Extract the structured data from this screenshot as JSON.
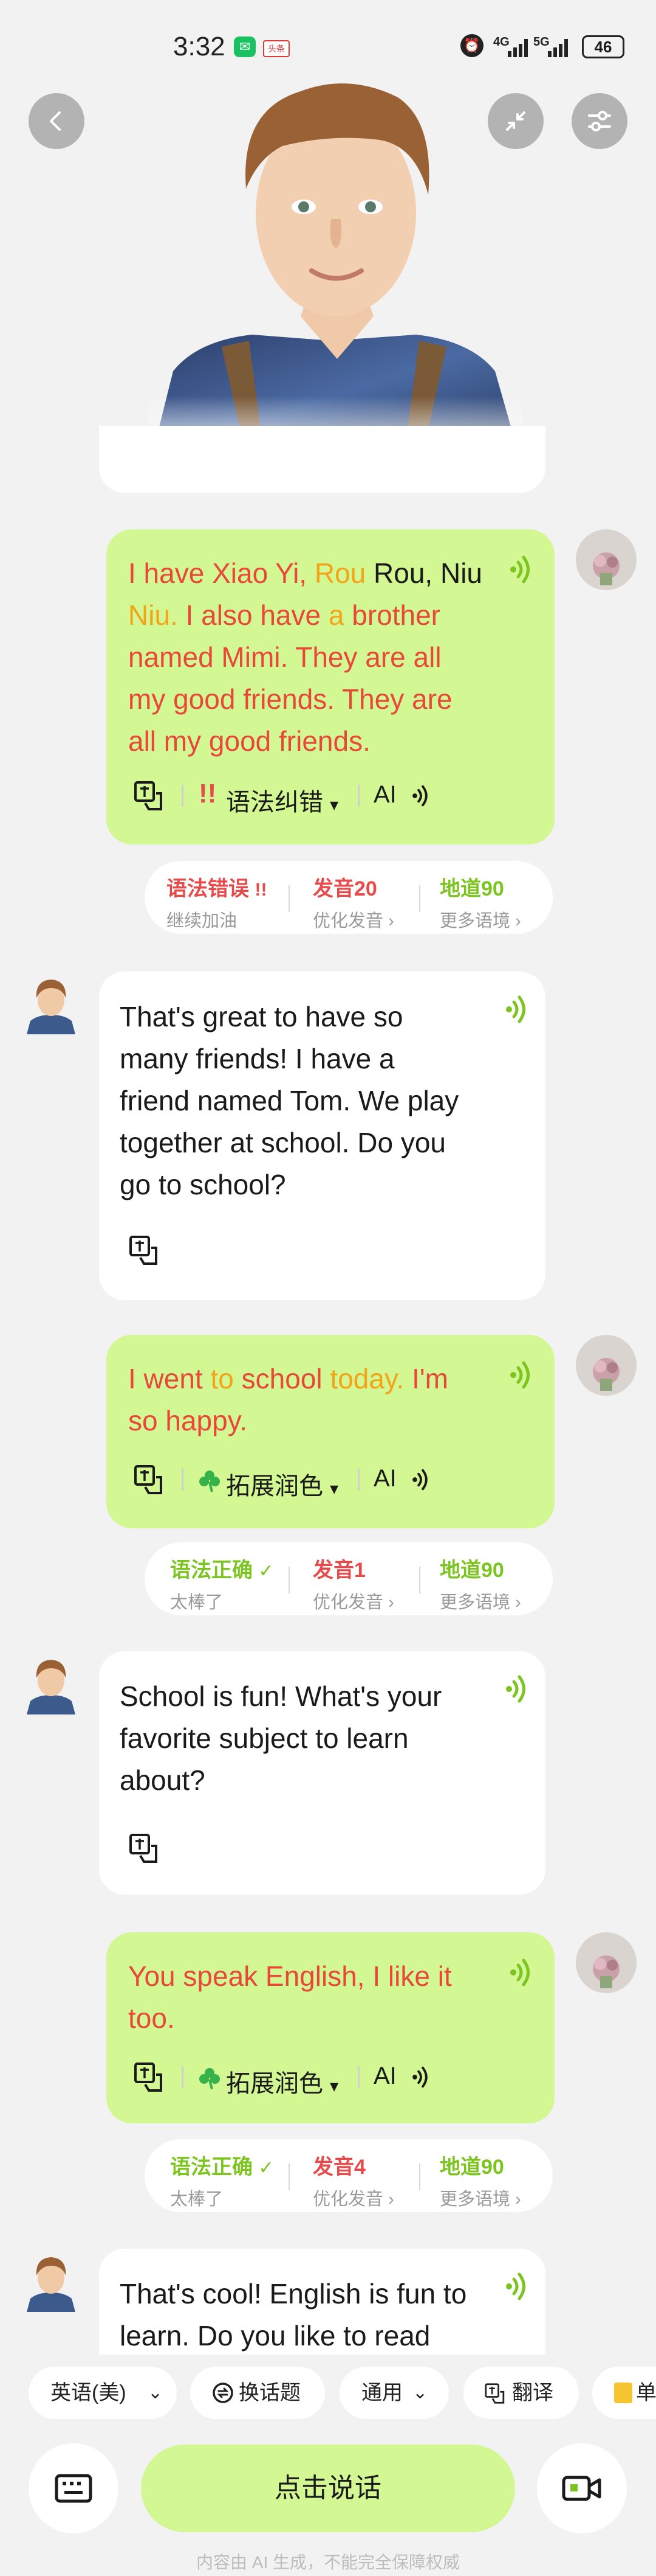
{
  "status": {
    "time": "3:32",
    "news_badge": "头条",
    "net1": "4G",
    "net2": "5G",
    "battery": "46"
  },
  "colors": {
    "user_bubble": "#d3f893",
    "accent_green": "#7cc520",
    "error_red": "#e84a4a",
    "highlight_orange": "#f3a419"
  },
  "icons": {
    "back": "chevron-left-icon",
    "minimize": "collapse-arrows-icon",
    "settings": "sliders-icon",
    "speaker": "sound-wave-icon",
    "translate": "translate-icon",
    "keyboard": "keyboard-icon",
    "video": "video-camera-icon",
    "clover": "clover-icon",
    "topic": "refresh-icon",
    "book": "notebook-icon"
  },
  "messages": {
    "u1": {
      "l1": {
        "a": "I have Xiao Yi, ",
        "b": "Rou",
        "c": " Rou, Niu"
      },
      "l2": {
        "a": "Niu.",
        "b": " I also have ",
        "c": "a",
        "d": " brother"
      },
      "l3": "named Mimi. They are all",
      "l4": "my good friends. They are",
      "l5": "all my good friends.",
      "grammar_btn": "语法纠错",
      "ai_label": "AI",
      "score": {
        "grammar": "语法错误",
        "grammar_sub": "继续加油",
        "pron": "发音20",
        "pron_sub": "优化发音",
        "idiom": "地道90",
        "idiom_sub": "更多语境"
      }
    },
    "a1": {
      "l1": "That's great to have so",
      "l2": "many friends! I have a",
      "l3": "friend named Tom. We play",
      "l4": "together at school. Do you",
      "l5": "go to school?"
    },
    "u2": {
      "l1": {
        "a": "I went ",
        "b": "to",
        "c": " school ",
        "d": "today.",
        "e": " I'm"
      },
      "l2": "so happy.",
      "polish_btn": "拓展润色",
      "ai_label": "AI",
      "score": {
        "grammar": "语法正确",
        "grammar_sub": "太棒了",
        "pron": "发音1",
        "pron_sub": "优化发音",
        "idiom": "地道90",
        "idiom_sub": "更多语境"
      }
    },
    "a2": {
      "l1": "School is fun! What's your",
      "l2": "favorite subject to learn",
      "l3": "about?"
    },
    "u3": {
      "l1": "You speak English, I like it",
      "l2": "too.",
      "polish_btn": "拓展润色",
      "ai_label": "AI",
      "score": {
        "grammar": "语法正确",
        "grammar_sub": "太棒了",
        "pron": "发音4",
        "pron_sub": "优化发音",
        "idiom": "地道90",
        "idiom_sub": "更多语境"
      }
    },
    "a3": {
      "l1": "That's cool! English is fun to",
      "l2": "learn. Do you like to read"
    }
  },
  "toolbar": {
    "language": "英语(美)",
    "topic": "换话题",
    "mode": "通用",
    "translate": "翻译",
    "words": "单"
  },
  "talk_button": "点击说话",
  "footer": "内容由 AI 生成，不能完全保障权威"
}
